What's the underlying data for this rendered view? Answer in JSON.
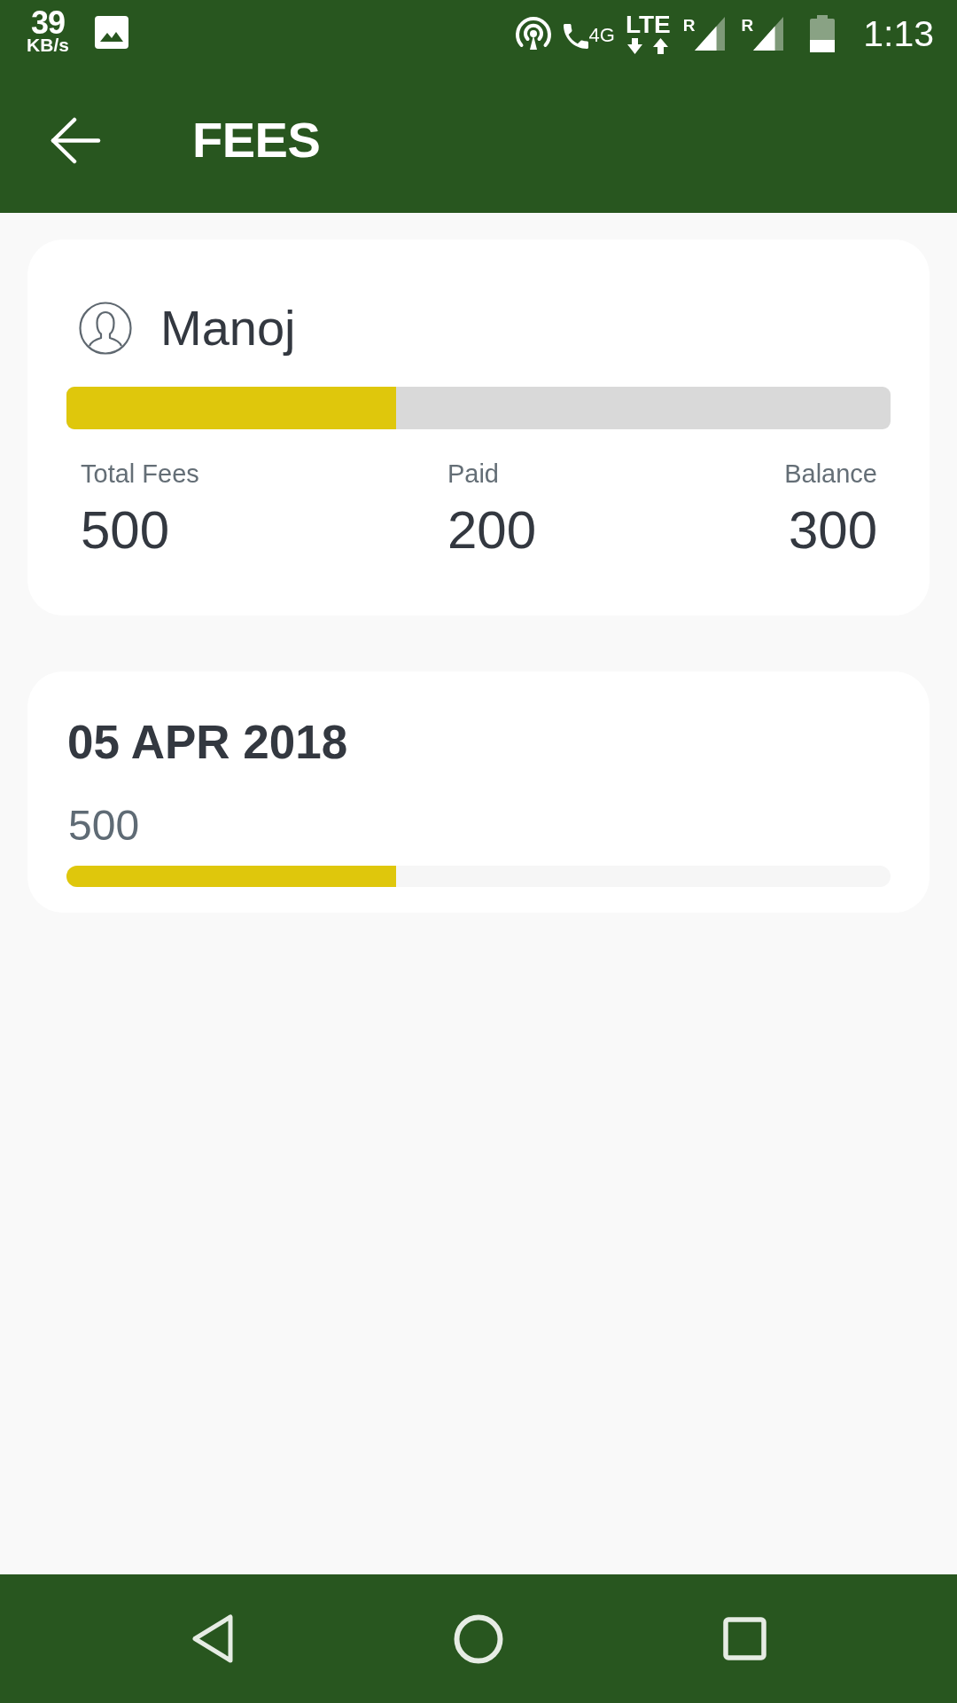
{
  "status_bar": {
    "speed": "39",
    "speed_unit": "KB/s",
    "call_label": "4G",
    "network": "LTE",
    "sim_labels": [
      "R",
      "R"
    ],
    "time": "1:13"
  },
  "app_bar": {
    "title": "FEES"
  },
  "summary": {
    "name": "Manoj",
    "level": 0.4,
    "stats": [
      {
        "label": "Total Fees",
        "value": "500"
      },
      {
        "label": "Paid",
        "value": "200"
      },
      {
        "label": "Balance",
        "value": "300"
      }
    ]
  },
  "payments": [
    {
      "date": "05 APR 2018",
      "amount": "500",
      "level": 0.4
    }
  ]
}
